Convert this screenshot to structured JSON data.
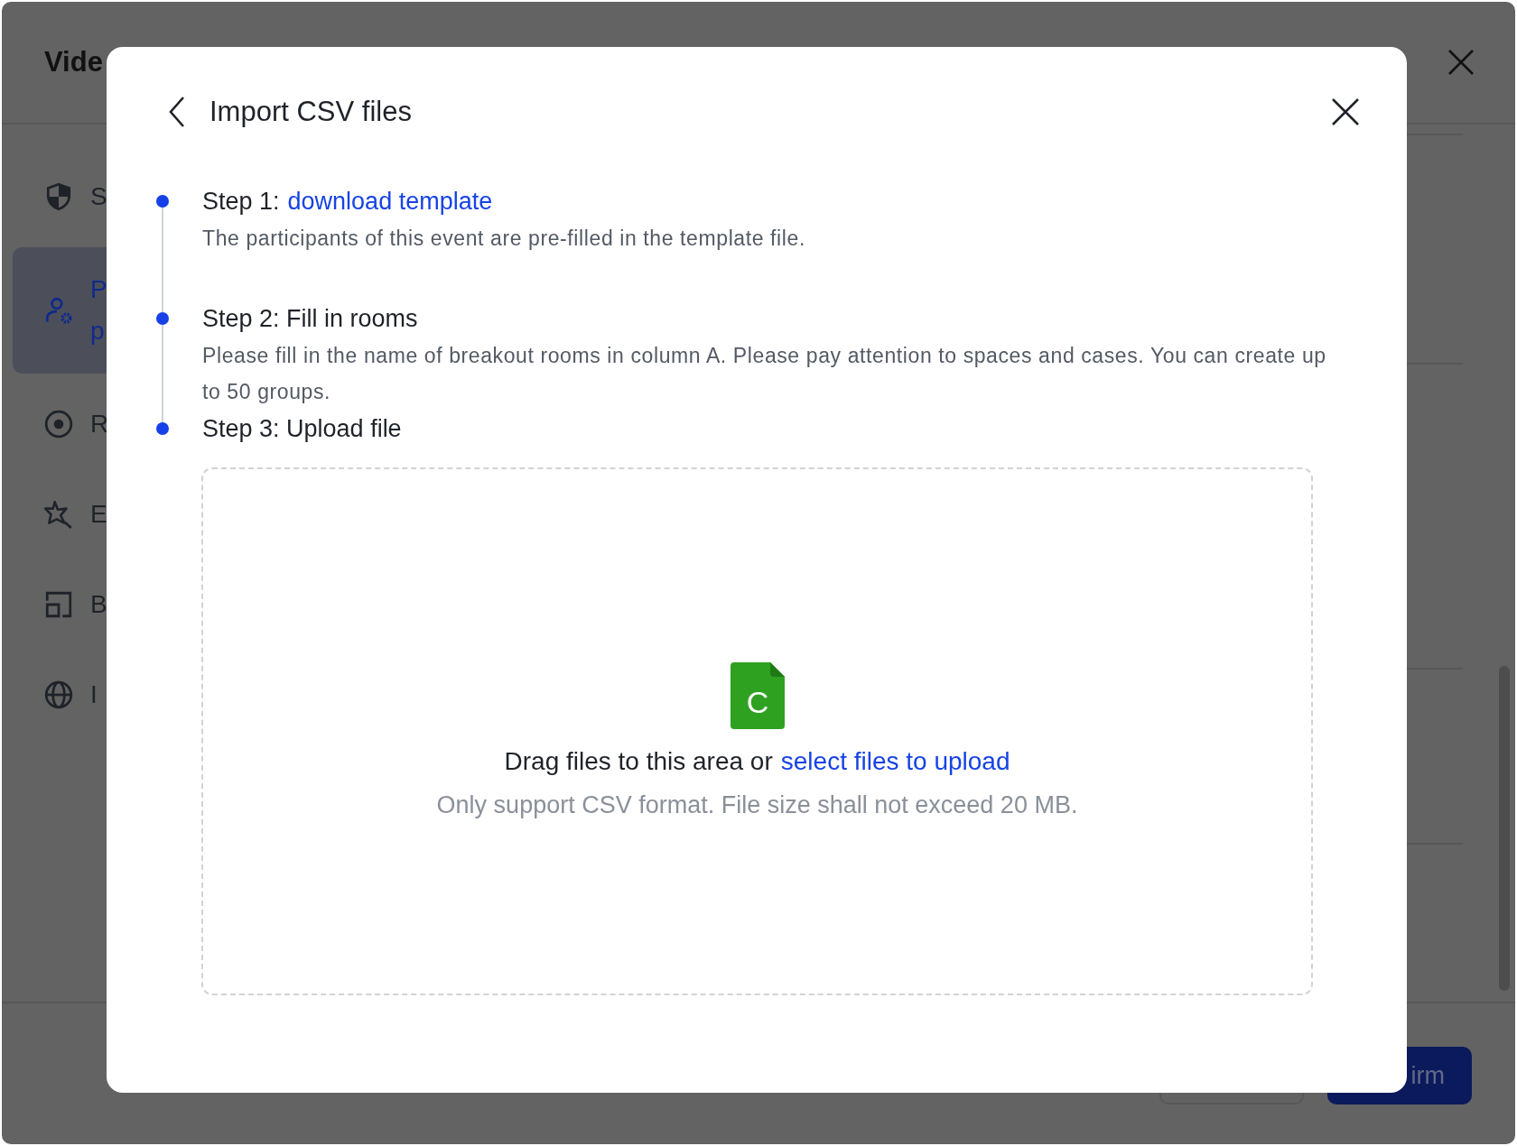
{
  "background_window": {
    "title": "Vide",
    "sidebar": {
      "items": [
        {
          "kind": "shield",
          "lines": [
            "S"
          ],
          "selected": false
        },
        {
          "kind": "user-gear",
          "lines": [
            "P",
            "p"
          ],
          "selected": true
        },
        {
          "kind": "record",
          "lines": [
            "R"
          ],
          "selected": false
        },
        {
          "kind": "star",
          "lines": [
            "E"
          ],
          "selected": false
        },
        {
          "kind": "layout",
          "lines": [
            "B"
          ],
          "selected": false
        },
        {
          "kind": "globe",
          "lines": [
            "I"
          ],
          "selected": false
        }
      ]
    },
    "confirm_button": "irm"
  },
  "dialog": {
    "title": "Import CSV files",
    "steps": [
      {
        "heading": "Step 1:",
        "link": "download template",
        "description": "The participants of this event are pre-filled in the template file."
      },
      {
        "heading": "Step 2: Fill in rooms",
        "description": "Please fill in the name of breakout rooms in column A. Please pay attention to spaces and cases. You can create up to 50 groups."
      },
      {
        "heading": "Step 3: Upload file"
      }
    ],
    "dropzone": {
      "file_letter": "C",
      "text": "Drag files to this area or",
      "link": "select files to upload",
      "hint": "Only support CSV format. File size shall not exceed 20 MB."
    }
  }
}
